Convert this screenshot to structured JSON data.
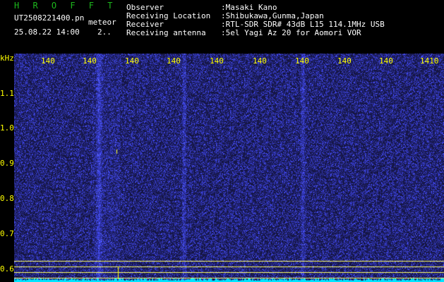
{
  "header": {
    "title": "H R O F F T",
    "filename": "UT2508221400.pn",
    "label": "meteor",
    "datetime": "25.08.22 14:00",
    "count": "2..",
    "fields": [
      {
        "label": "Observer",
        "value": ":Masaki Kano"
      },
      {
        "label": "Receiving Location",
        "value": ":Shibukawa,Gunma,Japan"
      },
      {
        "label": "Receiver",
        "value": ":RTL-SDR SDR# 43dB L15 114.1MHz USB"
      },
      {
        "label": "Receiving antenna",
        "value": ":5el Yagi Az 20 for Aomori VOR"
      }
    ]
  },
  "axis": {
    "unit": "kHz",
    "y_ticks": [
      "1.1",
      "1.0",
      "0.9",
      "0.8",
      "0.7",
      "0.6"
    ],
    "x_ticks": [
      "140",
      "140",
      "140",
      "140",
      "140",
      "140",
      "140",
      "140",
      "140",
      "1410"
    ]
  },
  "colors": {
    "background": "#000010",
    "waterfall_base": "#0a0a7a",
    "noise": "#3a3aff",
    "baseline": "#00e5ff",
    "title": "#1db81d",
    "axis": "#ffff00"
  }
}
